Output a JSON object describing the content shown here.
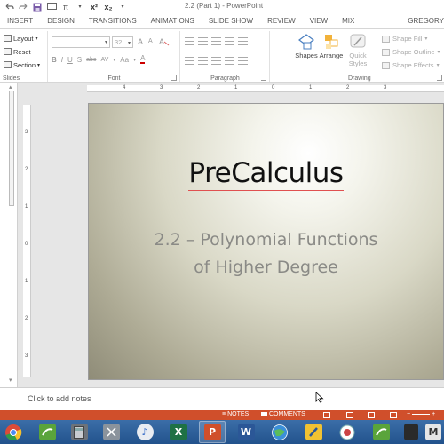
{
  "window": {
    "title": "2.2 (Part 1) - PowerPoint",
    "user": "GREGORY"
  },
  "qat": {
    "undo_icon": "undo-icon",
    "pi_label": "π",
    "superscript_label": "x²",
    "subscript_label": "x₂"
  },
  "tabs": [
    {
      "label": "INSERT"
    },
    {
      "label": "DESIGN"
    },
    {
      "label": "TRANSITIONS"
    },
    {
      "label": "ANIMATIONS"
    },
    {
      "label": "SLIDE SHOW"
    },
    {
      "label": "REVIEW"
    },
    {
      "label": "VIEW"
    },
    {
      "label": "MIX"
    }
  ],
  "ribbon": {
    "slides": {
      "layout": "Layout",
      "reset": "Reset",
      "section": "Section",
      "label": "Slides"
    },
    "font": {
      "name": "",
      "size": "32",
      "label": "Font",
      "bold": "B",
      "italic": "I",
      "underline": "U",
      "shadow": "S",
      "strike": "abc",
      "spacing": "AV",
      "case": "Aa",
      "grow": "A",
      "shrink": "A"
    },
    "paragraph": {
      "label": "Paragraph"
    },
    "drawing": {
      "label": "Drawing",
      "shapes": "Shapes",
      "arrange": "Arrange",
      "quick_styles_1": "Quick",
      "quick_styles_2": "Styles",
      "shape_fill": "Shape Fill",
      "shape_outline": "Shape Outline",
      "shape_effects": "Shape Effects"
    }
  },
  "ruler": {
    "h": [
      "4",
      "3",
      "2",
      "1",
      "0",
      "1",
      "2",
      "3"
    ],
    "v": [
      "3",
      "2",
      "1",
      "0",
      "1",
      "2",
      "3"
    ]
  },
  "slide": {
    "title": "PreCalculus",
    "subtitle_line1": "2.2 – Polynomial Functions",
    "subtitle_line2": "of Higher Degree"
  },
  "notes": {
    "placeholder": "Click to add notes"
  },
  "statusbar": {
    "notes": "NOTES",
    "comments": "COMMENTS",
    "accent": "#d04f2b"
  },
  "taskbar": {
    "apps": [
      {
        "name": "chrome",
        "letter": ""
      },
      {
        "name": "mix-app",
        "letter": ""
      },
      {
        "name": "calculator",
        "letter": ""
      },
      {
        "name": "snipping-tool",
        "letter": ""
      },
      {
        "name": "itunes",
        "letter": "♪"
      },
      {
        "name": "excel",
        "letter": "X"
      },
      {
        "name": "powerpoint",
        "letter": "P"
      },
      {
        "name": "word",
        "letter": "W"
      },
      {
        "name": "browser",
        "letter": ""
      },
      {
        "name": "paint",
        "letter": ""
      },
      {
        "name": "network",
        "letter": ""
      },
      {
        "name": "mix-app-2",
        "letter": ""
      },
      {
        "name": "app-dark",
        "letter": ""
      },
      {
        "name": "app-m",
        "letter": "M"
      }
    ]
  }
}
